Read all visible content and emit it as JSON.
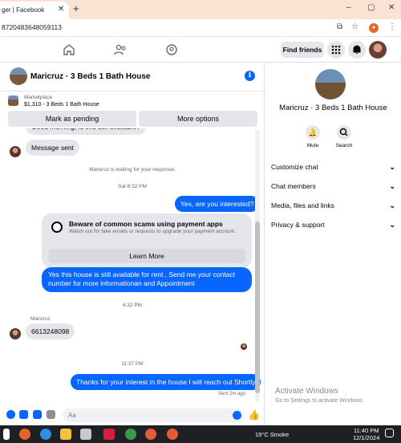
{
  "browser": {
    "tab_title": "ger | Facebook",
    "tab_close": "✕",
    "new_tab": "+",
    "url": "8720483648059113",
    "win_min": "–",
    "win_max": "▢",
    "win_close": "✕"
  },
  "fbnav": {
    "find_friends": "Find friends"
  },
  "chat": {
    "title": "Maricruz · 3 Beds 1 Bath House",
    "info": "i",
    "marketplace_label": "Marketplace",
    "listing": "$1,310 - 3 Beds 1 Bath House",
    "mark_pending": "Mark as pending",
    "more_options": "More options",
    "messages": {
      "partial_top": "Good morning, Is this still available?",
      "message_sent": "Message sent",
      "waiting": "Maricruz is waiting for your response.",
      "time1": "Sat 8:32 PM",
      "yes_interested": "Yes, are you interested?",
      "scam_title": "Beware of common scams using payment apps",
      "scam_body": "Watch out for fake emails or requests to upgrade your payment account.",
      "learn_more": "Learn More",
      "long_reply": "Yes this house is still available for rent , Send me your contact number for more informationan and Appointment",
      "time2": "4:32 PM",
      "sender_name": "Maricruz",
      "phone": "6613248098",
      "time3": "11:37 PM",
      "thanks": "Thanks for your interest in the house I will reach out Shortly",
      "sent_ago": "Sent 2m ago"
    },
    "composer_placeholder": "Aa"
  },
  "right_panel": {
    "title": "Maricruz · 3 Beds 1 Bath House",
    "mute": "Mute",
    "search": "Search",
    "rows": [
      "Customize chat",
      "Chat members",
      "Media, files and links",
      "Privacy & support"
    ],
    "activate_title": "Activate Windows",
    "activate_sub": "Go to Settings to activate Windows."
  },
  "taskbar": {
    "weather": "19°C  Smoke",
    "time": "11:40 PM",
    "date": "12/1/2024"
  },
  "colors": {
    "accent": "#0866ff",
    "bubble_in": "#e4e6eb",
    "tabstrip": "#fbe3d3"
  }
}
